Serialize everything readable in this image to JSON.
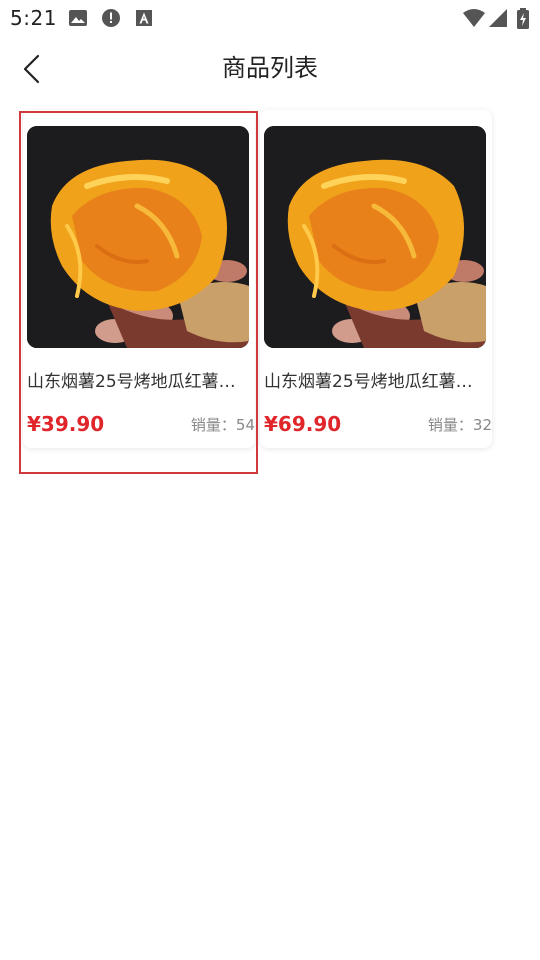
{
  "status_bar": {
    "time": "5:21",
    "icons": [
      "image-icon",
      "alert-icon",
      "font-icon",
      "wifi-icon",
      "signal-icon",
      "battery-charging-icon"
    ]
  },
  "header": {
    "title": "商品列表",
    "back_icon": "chevron-left-icon"
  },
  "products": [
    {
      "name": "山东烟薯25号烤地瓜红薯…",
      "price": "¥39.90",
      "sales": "销量：54",
      "image": "baked-sweet-potato-photo"
    },
    {
      "name": "山东烟薯25号烤地瓜红薯…",
      "price": "¥69.90",
      "sales": "销量：32",
      "image": "baked-sweet-potato-photo"
    }
  ],
  "colors": {
    "price": "#e0262b",
    "selection_outline": "#d0393e"
  }
}
